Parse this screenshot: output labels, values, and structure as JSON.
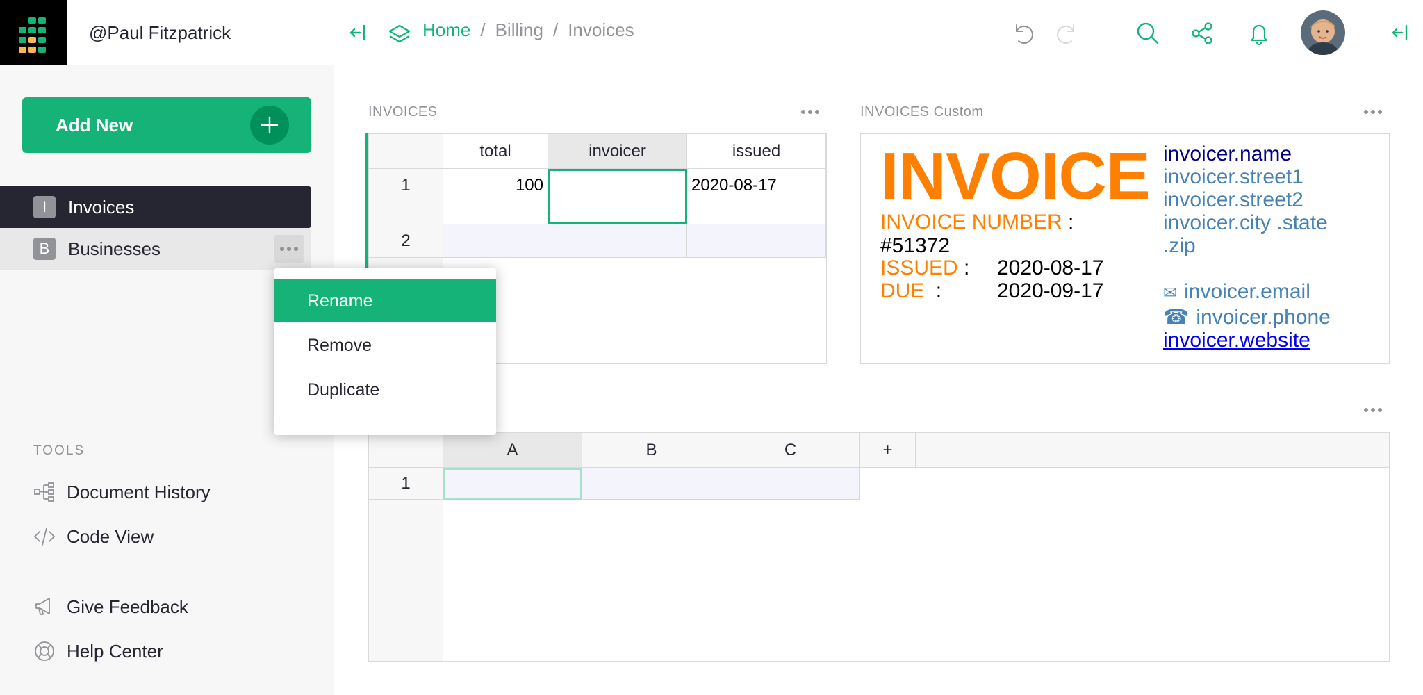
{
  "account": {
    "name": "@Paul Fitzpatrick"
  },
  "left_panel": {
    "add_new_label": "Add New",
    "pages": [
      {
        "initial": "I",
        "label": "Invoices",
        "state": "active"
      },
      {
        "initial": "B",
        "label": "Businesses",
        "state": "hover"
      }
    ],
    "tools_label": "TOOLS",
    "tools": [
      {
        "label": "Document History",
        "icon": "document-history-icon"
      },
      {
        "label": "Code View",
        "icon": "code-icon"
      },
      {
        "label": "Give Feedback",
        "icon": "megaphone-icon"
      },
      {
        "label": "Help Center",
        "icon": "lifebuoy-icon"
      }
    ]
  },
  "context_menu": {
    "items": [
      {
        "label": "Rename",
        "selected": true
      },
      {
        "label": "Remove",
        "selected": false
      },
      {
        "label": "Duplicate",
        "selected": false
      }
    ]
  },
  "breadcrumb": {
    "home": "Home",
    "sep": "/",
    "items": [
      "Billing",
      "Invoices"
    ]
  },
  "colors": {
    "accent": "#16b378",
    "dark": "#262633",
    "muted": "#929299",
    "orange": "#ff8000",
    "steelblue": "#4682b4",
    "navy": "#000080"
  },
  "invoices_table": {
    "title": "INVOICES",
    "columns": [
      "total",
      "invoicer",
      "issued"
    ],
    "rows": [
      {
        "num": "1",
        "cells": [
          "100",
          "",
          "2020-08-17"
        ]
      },
      {
        "num": "2",
        "cells": [
          "",
          "",
          ""
        ]
      }
    ]
  },
  "custom_widget": {
    "title": "INVOICES Custom",
    "heading": "INVOICE",
    "number_label": "INVOICE NUMBER",
    "colon": ":",
    "number_value": "#51372",
    "issued_label": "ISSUED",
    "issued_value": "2020-08-17",
    "due_label": "DUE",
    "due_value": "2020-09-17",
    "invoicer": {
      "name": "invoicer.name",
      "street1": "invoicer.street1",
      "street2": "invoicer.street2",
      "city_state": "invoicer.city .state",
      "zip": ".zip",
      "email_icon": "✉",
      "email": "invoicer.email",
      "phone_icon": "☎",
      "phone": "invoicer.phone",
      "website": "invoicer.website"
    }
  },
  "bottom_table": {
    "columns": [
      "A",
      "B",
      "C"
    ],
    "add_column": "+",
    "rows": [
      {
        "num": "1"
      }
    ]
  }
}
